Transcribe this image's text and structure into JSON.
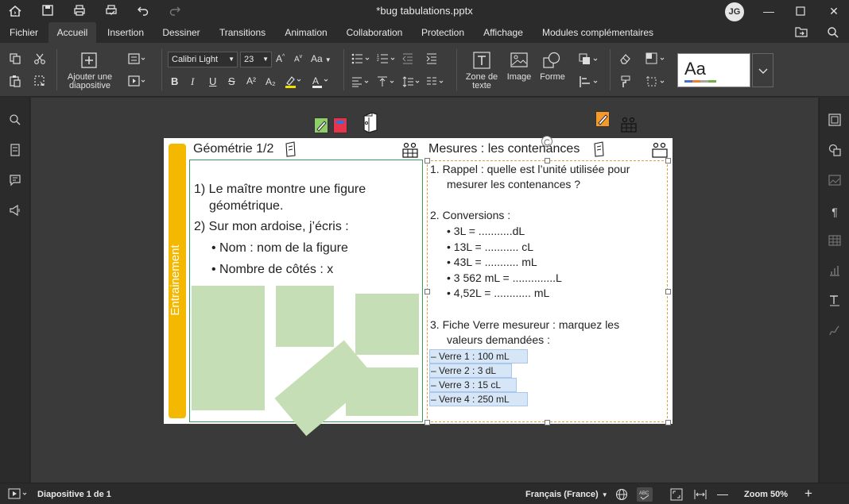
{
  "window": {
    "title": "*bug tabulations.pptx",
    "user_initials": "JG"
  },
  "menu": {
    "tabs": [
      "Fichier",
      "Accueil",
      "Insertion",
      "Dessiner",
      "Transitions",
      "Animation",
      "Collaboration",
      "Protection",
      "Affichage",
      "Modules complémentaires"
    ],
    "active_tab": "Accueil"
  },
  "ribbon": {
    "add_slide_label_1": "Ajouter une",
    "add_slide_label_2": "diapositive",
    "font_name": "Calibri Light",
    "font_size": "23",
    "textbox_label_1": "Zone de",
    "textbox_label_2": "texte",
    "image_label": "Image",
    "shape_label": "Forme",
    "theme_preview": "Aa",
    "bold": "B",
    "italic": "I",
    "underline": "U",
    "strike": "S",
    "superscript": "A²",
    "subscript": "A₂",
    "case_label": "Aa",
    "grow_font": "A",
    "shrink_font": "A",
    "font_color_letter": "A",
    "highlight_color": "#f0e000",
    "font_color": "#e8e8e8"
  },
  "slide": {
    "vertical_label": "Entrainement",
    "left_title": "Géométrie 1/2",
    "left_items": [
      "1)  Le maître montre une figure",
      "géométrique.",
      "2)  Sur mon ardoise, j’écris :",
      "•   Nom : nom de la figure",
      "•   Nombre de côtés : x"
    ],
    "right_title": "Mesures : les contenances",
    "right_lines": [
      "1.  Rappel : quelle est l’unité utilisée pour",
      "mesurer les contenances ?",
      "2.  Conversions :",
      "•     3L = ...........dL",
      "•     13L = ........... cL",
      "•     43L = ........... mL",
      "•     3 562 mL = ..............L",
      "•     4,52L = ............ mL",
      "3.  Fiche Verre mesureur : marquez les",
      "valeurs demandées :"
    ],
    "verres": [
      "– Verre 1 : 100 mL",
      "– Verre 2 : 3 dL",
      "– Verre 3 : 15 cL",
      "– Verre 4 : 250 mL"
    ],
    "accent_color": "#f5b800",
    "green_shape_color": "#c5deb5",
    "selection_color": "#e0a040"
  },
  "status": {
    "slide_indicator": "Diapositive 1 de 1",
    "language": "Français (France)",
    "zoom": "Zoom 50%"
  }
}
